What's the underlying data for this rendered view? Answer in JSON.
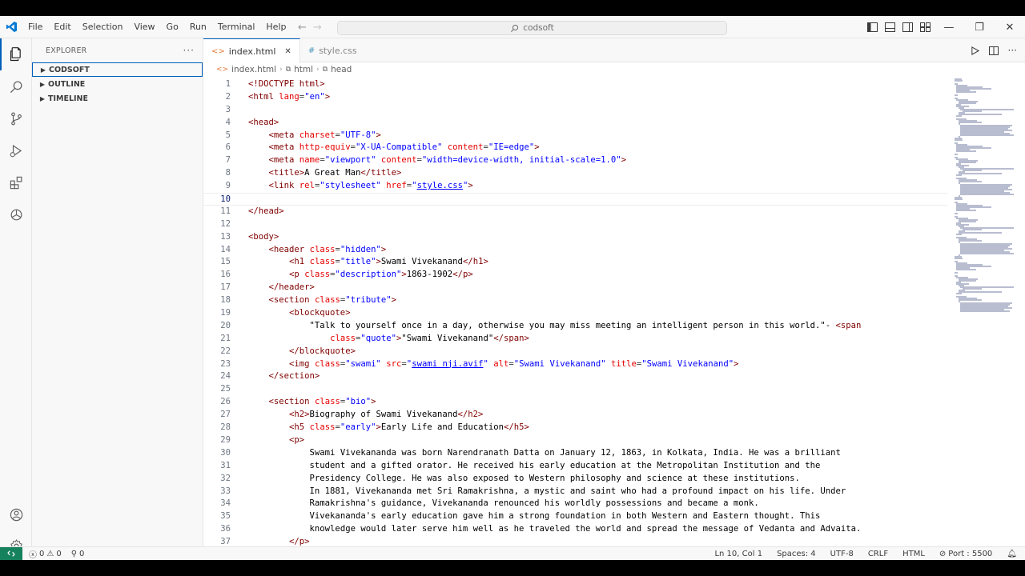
{
  "window": {
    "search_text": "codsoft"
  },
  "menu": [
    "File",
    "Edit",
    "Selection",
    "View",
    "Go",
    "Run",
    "Terminal",
    "Help"
  ],
  "sidebar": {
    "title": "EXPLORER",
    "sections": [
      "CODSOFT",
      "OUTLINE",
      "TIMELINE"
    ]
  },
  "tabs": [
    {
      "label": "index.html",
      "icon": "html-file-icon",
      "active": true
    },
    {
      "label": "style.css",
      "icon": "css-file-icon",
      "active": false
    }
  ],
  "breadcrumb": [
    "index.html",
    "html",
    "head"
  ],
  "editor": {
    "current_line": 10,
    "lines": [
      "1",
      "2",
      "3",
      "4",
      "5",
      "6",
      "7",
      "8",
      "9",
      "10",
      "11",
      "12",
      "13",
      "14",
      "15",
      "16",
      "17",
      "18",
      "19",
      "20",
      "21",
      "22",
      "23",
      "24",
      "25",
      "26",
      "27",
      "28",
      "29",
      "30",
      "31",
      "32",
      "33",
      "34",
      "35",
      "36",
      "37"
    ]
  },
  "statusbar": {
    "errors": "0",
    "warnings": "0",
    "ports": "0",
    "position": "Ln 10, Col 1",
    "spaces": "Spaces: 4",
    "encoding": "UTF-8",
    "eol": "CRLF",
    "language": "HTML",
    "port": "Port : 5500"
  },
  "colors": {
    "accent": "#005fb8",
    "remote": "#16825d",
    "tag": "#800000",
    "attribute": "#e50000",
    "string": "#0000ff"
  }
}
